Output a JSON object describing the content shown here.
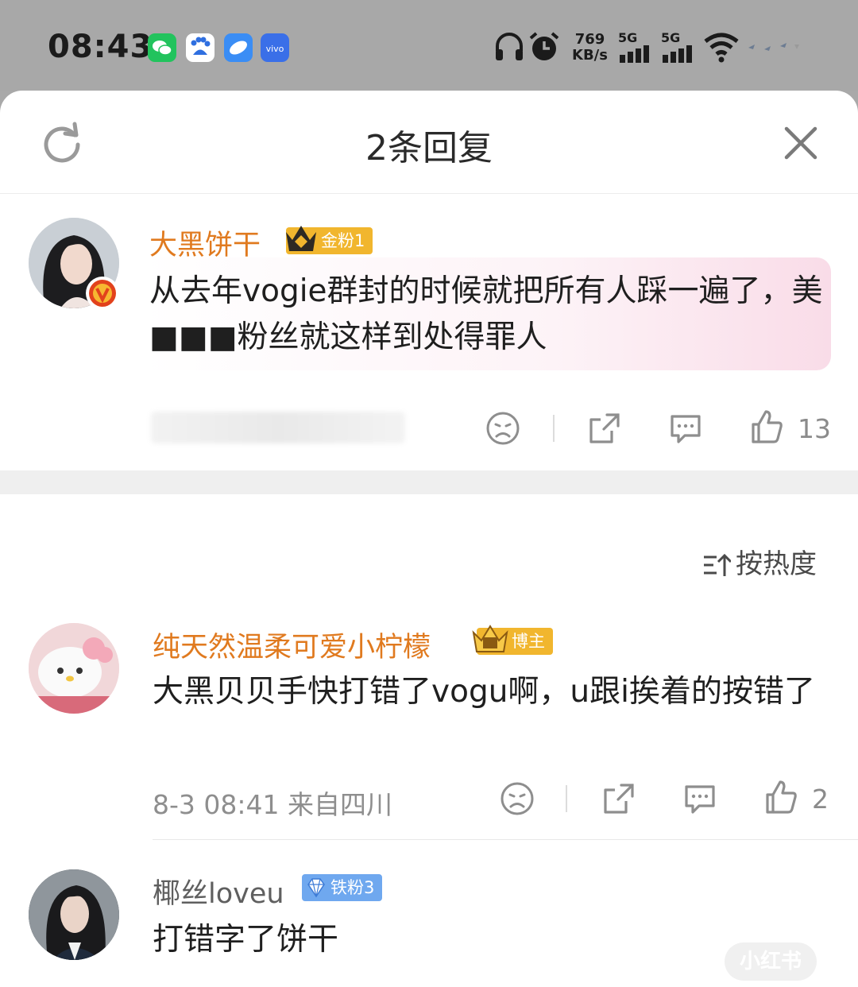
{
  "status_bar": {
    "time": "08:43",
    "app_icons": [
      "wechat-icon",
      "baidu-icon",
      "browser-icon",
      "vivo-icon"
    ],
    "speed_value": "769",
    "speed_unit": "KB/s",
    "network1": "5G",
    "network2": "5G"
  },
  "header": {
    "title": "2条回复"
  },
  "main_comment": {
    "username": "大黑饼干",
    "badge": "金粉1",
    "text": "从去年vogie群封的时候就把所有人踩一遍了，美■■■粉丝就这样到处得罪人",
    "likes": "13"
  },
  "sort_label": "按热度",
  "replies": [
    {
      "username": "纯天然温柔可爱小柠檬",
      "badge": "博主",
      "text": "大黑贝贝手快打错了vogu啊，u跟i挨着的按错了",
      "meta": "8-3 08:41 来自四川",
      "likes": "2"
    },
    {
      "username": "椰丝loveu",
      "badge": "铁粉3",
      "text": "打错字了饼干"
    }
  ],
  "watermark": "小红书",
  "colors": {
    "username_orange": "#e07a1f",
    "username_gray": "#5f5f5f",
    "gold_badge": "#f1b62e",
    "iron_badge": "#6fa8ef",
    "verify_red": "#e2421c"
  }
}
